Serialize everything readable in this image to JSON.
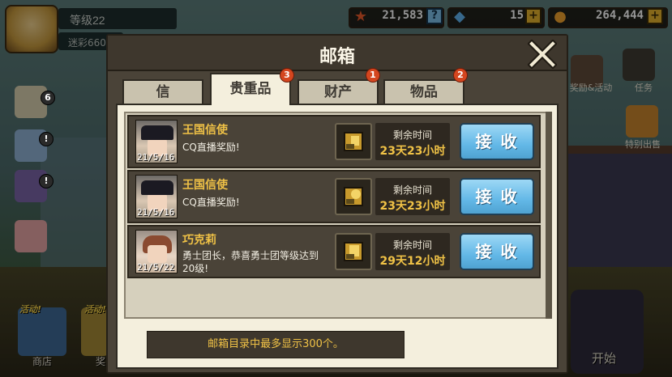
{
  "player": {
    "level": "等级22",
    "sub": "迷彩660"
  },
  "resources": {
    "medals": "21,583",
    "gems": "15",
    "coins": "264,444",
    "help_label": "?",
    "plus_label": "+"
  },
  "side_menu": {
    "event_label": "奖励&活动",
    "quest_label": "任务",
    "special_label": "特别出售",
    "mail_count": "6",
    "alert": "!",
    "shop_label": "商店",
    "start_label": "开始",
    "activity_tag": "活动!",
    "partial_label": "奖"
  },
  "mailbox": {
    "title": "邮箱",
    "tabs": [
      {
        "label": "信",
        "badge": ""
      },
      {
        "label": "贵重品",
        "badge": "3"
      },
      {
        "label": "财产",
        "badge": "1"
      },
      {
        "label": "物品",
        "badge": "2"
      }
    ],
    "active_tab": "贵重品",
    "mails": [
      {
        "sender": "王国信使",
        "message": "CQ直播奖励!",
        "date": "21/5/16",
        "time_label": "剩余时间",
        "time_left": "23天23小时",
        "button": "接 收"
      },
      {
        "sender": "王国信使",
        "message": "CQ直播奖励!",
        "date": "21/5/16",
        "time_label": "剩余时间",
        "time_left": "23天23小时",
        "button": "接 收"
      },
      {
        "sender": "巧克莉",
        "message": "勇士团长，恭喜勇士团等级达到20级!",
        "date": "21/5/22",
        "time_label": "剩余时间",
        "time_left": "29天12小时",
        "button": "接 收"
      }
    ],
    "footer_note": "邮箱目录中最多显示300个。"
  },
  "colors": {
    "accent_gold": "#f0c246",
    "button_blue": "#63b8e7",
    "badge_red": "#d4461f",
    "panel_dark": "#4a4338",
    "panel_light": "#f4efdd"
  }
}
